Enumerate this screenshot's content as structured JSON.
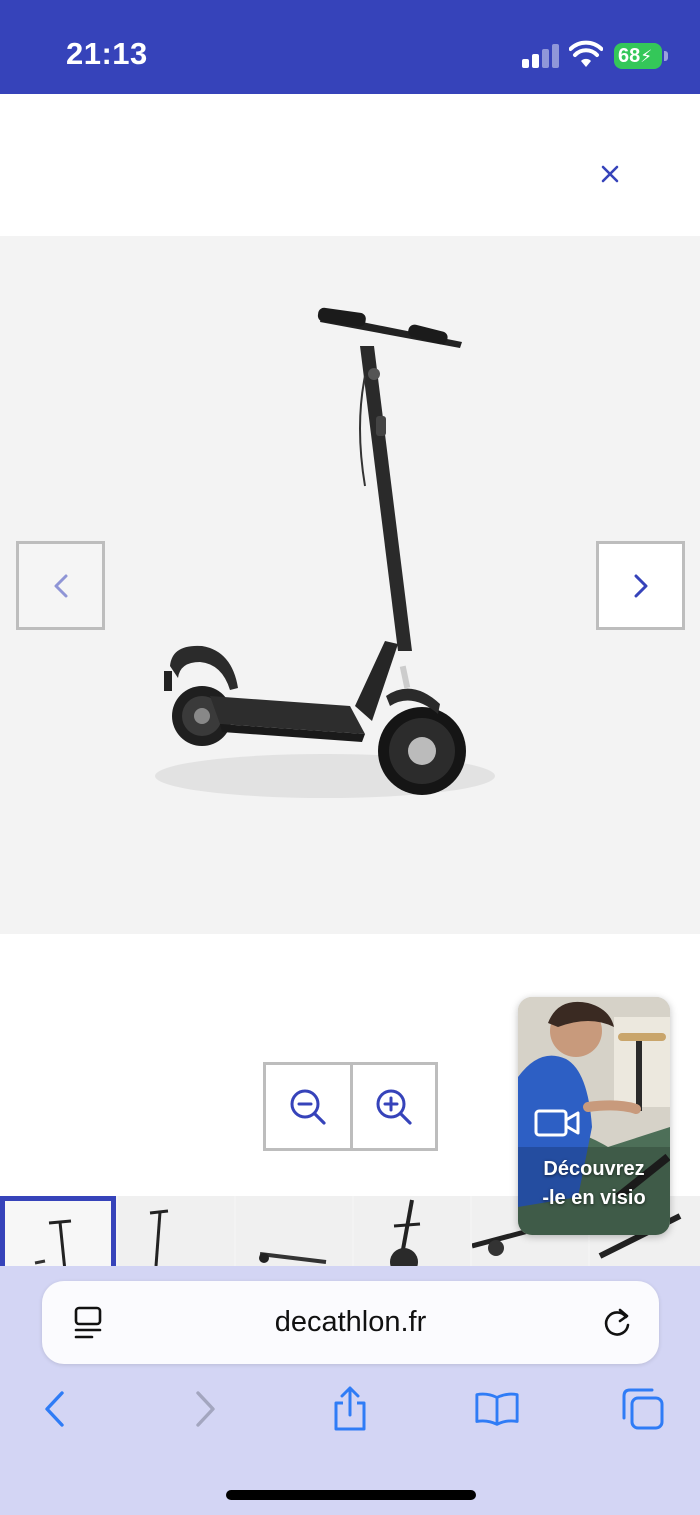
{
  "status_bar": {
    "time": "21:13",
    "battery": "68",
    "background": "#3643ba"
  },
  "close": {
    "icon": "close-icon",
    "color": "#3643ba"
  },
  "gallery": {
    "image_alt": "electric-scooter-photo",
    "prev_icon": "chevron-left-icon",
    "next_icon": "chevron-right-icon"
  },
  "zoom": {
    "zoom_out_icon": "zoom-out-icon",
    "zoom_in_icon": "zoom-in-icon"
  },
  "thumbnails": {
    "count_visible": 6,
    "selected_index": 0
  },
  "video": {
    "label_line1": "Découvrez",
    "label_line2": "-le en visio",
    "icon": "video-camera-icon"
  },
  "browser": {
    "url": "decathlon.fr",
    "reader_icon": "page-menu-icon",
    "reload_icon": "reload-icon",
    "toolbar": [
      "back-icon",
      "forward-icon",
      "share-icon",
      "bookmarks-icon",
      "tabs-icon"
    ]
  },
  "colors": {
    "brand": "#3643ba",
    "browser_bg": "#d3d5f4",
    "toolbar_icon": "#2f7cf6"
  }
}
